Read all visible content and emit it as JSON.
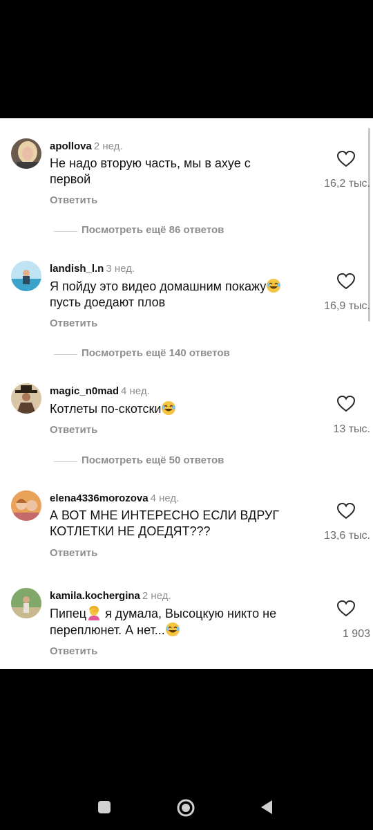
{
  "comments": [
    {
      "username": "apollova",
      "time": "2 нед.",
      "text_lines": [
        "Не надо вторую часть, мы в ахуе с",
        "первой"
      ],
      "reply_label": "Ответить",
      "likes": "16,2 тыс.",
      "more_replies": "Посмотреть ещё 86 ответов",
      "emoji": "",
      "avatar_icon": "avatar-woman-blonde-icon"
    },
    {
      "username": "landish_l.n",
      "time": "3 нед.",
      "text_lines": [
        "Я пойду это видео домашним покажу",
        "пусть доедают плов"
      ],
      "reply_label": "Ответить",
      "likes": "16,9 тыс.",
      "more_replies": "Посмотреть ещё 140 ответов",
      "emoji": "😂",
      "avatar_icon": "avatar-beach-photo-icon"
    },
    {
      "username": "magic_n0mad",
      "time": "4 нед.",
      "text_lines": [
        "Котлеты по-скотски"
      ],
      "reply_label": "Ответить",
      "likes": "13 тыс.",
      "more_replies": "Посмотреть ещё 50 ответов",
      "emoji": "😂",
      "avatar_icon": "avatar-cowboy-icon"
    },
    {
      "username": "elena4336morozova",
      "time": "4 нед.",
      "text_lines": [
        "А ВОТ МНЕ ИНТЕРЕСНО ЕСЛИ ВДРУГ",
        "КОТЛЕТКИ НЕ ДОЕДЯТ???"
      ],
      "reply_label": "Ответить",
      "likes": "13,6 тыс.",
      "avatar_icon": "avatar-two-women-icon"
    },
    {
      "username": "kamila.kochergina",
      "time": "2 нед.",
      "text_lines": [
        "Пипец",
        " я думала, Высоцкую никто не",
        "переплюнет. А нет..."
      ],
      "reply_label": "Ответить",
      "likes": "1 903",
      "emoji_facepalm": "🤦‍♀️",
      "emoji": "😂",
      "avatar_icon": "avatar-outdoor-photo-icon"
    }
  ],
  "navigation": {
    "recents_icon": "square-recents-icon",
    "home_icon": "circle-home-icon",
    "back_icon": "triangle-back-icon"
  },
  "colors": {
    "background": "#000000",
    "sheet": "#ffffff",
    "text": "#111111",
    "secondary": "#8e8e8e",
    "laugh_emoji": "#f5c542"
  }
}
